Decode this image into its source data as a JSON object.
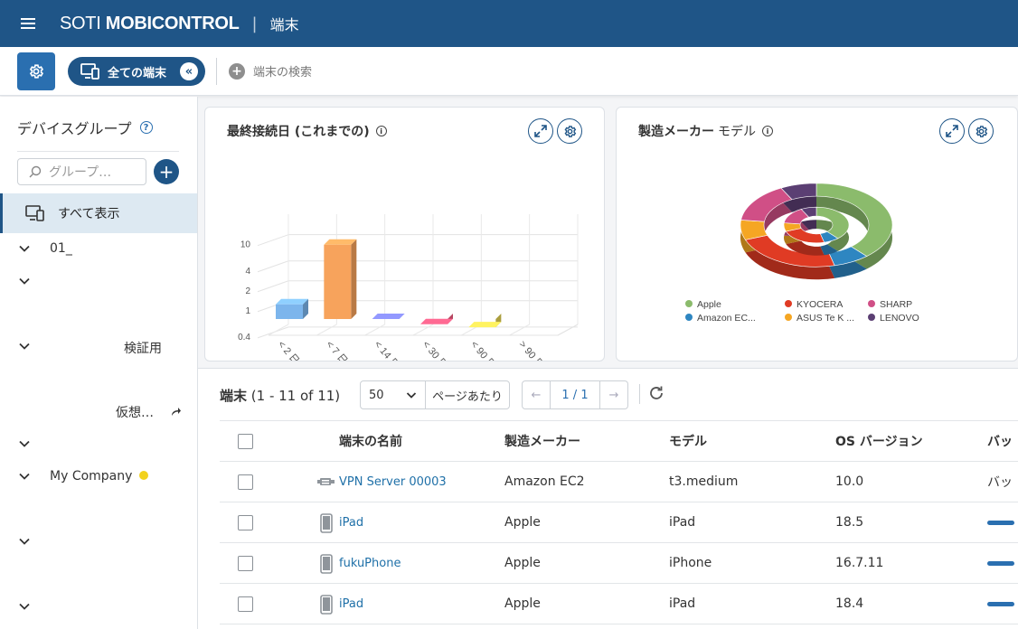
{
  "header": {
    "brand_light": "SOTI ",
    "brand_bold": "MOBICONTROL",
    "page_title": "端末"
  },
  "toolbar": {
    "all_devices_label": "全ての端末",
    "collapse_glyph": "«",
    "add_search_label": "端末の検索"
  },
  "sidebar": {
    "title": "デバイスグループ",
    "search_placeholder": "グループ…",
    "selected_item": "すべて表示",
    "tree": [
      {
        "label": "01_"
      },
      {
        "label": ""
      },
      {
        "label": "検証用"
      },
      {
        "label": "仮想…"
      },
      {
        "label": ""
      },
      {
        "label": "My Company"
      },
      {
        "label": ""
      },
      {
        "label": ""
      }
    ],
    "colors": {
      "my_company_dot": "#f2d21e"
    }
  },
  "chart_data": [
    {
      "type": "bar",
      "title": "最終接続日 (これまでの)",
      "categories": [
        "< 2 日",
        "< 7 日",
        "< 14 日",
        "< 30 日",
        "< 90 日",
        "> 90 日間"
      ],
      "values": [
        1,
        8,
        0.6,
        0.5,
        0.45,
        0
      ],
      "yscale": "log",
      "yticks": [
        "0.4",
        "1",
        "2",
        "4",
        "10"
      ],
      "colors": [
        "#7cb5ec",
        "#f7a35c",
        "#8085e9",
        "#f15c80",
        "#e4d354",
        "#2b908f"
      ],
      "grid": true
    },
    {
      "type": "pie",
      "title": "製造メーカー",
      "subtitle": "モデル",
      "series": [
        {
          "name": "Apple",
          "value": 5,
          "color": "#8bbb6c"
        },
        {
          "name": "Amazon EC...",
          "value": 1,
          "color": "#2e86c1"
        },
        {
          "name": "KYOCERA",
          "value": 3,
          "color": "#e03b24"
        },
        {
          "name": "ASUS Te K ...",
          "value": 1,
          "color": "#f5a623"
        },
        {
          "name": "SHARP",
          "value": 2,
          "color": "#d04f86"
        },
        {
          "name": "LENOVO",
          "value": 1,
          "color": "#5b3f73"
        }
      ],
      "legend_position": "bottom"
    }
  ],
  "devices": {
    "title": "端末",
    "range": "(1 - 11 of 11)",
    "per_page_value": "50",
    "per_page_label": "ページあたり",
    "page": "1 / 1",
    "columns": [
      "端末の名前",
      "製造メーカー",
      "モデル",
      "OS バージョン",
      "バッ"
    ],
    "rows": [
      {
        "icon": "server-icon",
        "name": "VPN Server 00003",
        "maker": "Amazon EC2",
        "model": "t3.medium",
        "os": "10.0",
        "battery_text": "バッ"
      },
      {
        "icon": "phone-icon",
        "name": "iPad",
        "maker": "Apple",
        "model": "iPad",
        "os": "18.5",
        "battery_text": ""
      },
      {
        "icon": "phone-icon",
        "name": "fukuPhone",
        "maker": "Apple",
        "model": "iPhone",
        "os": "16.7.11",
        "battery_text": ""
      },
      {
        "icon": "phone-icon",
        "name": "iPad",
        "maker": "Apple",
        "model": "iPad",
        "os": "18.4",
        "battery_text": ""
      }
    ]
  }
}
